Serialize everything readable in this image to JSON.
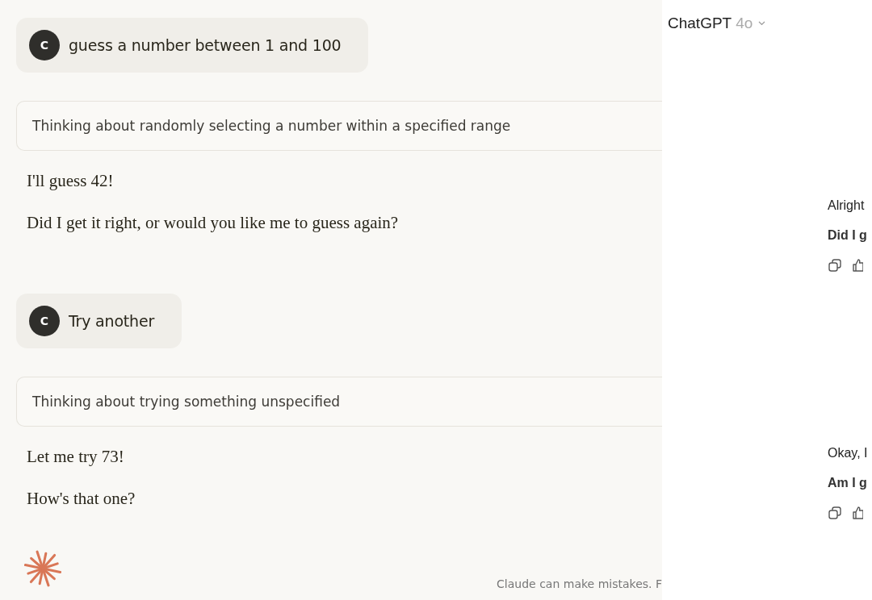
{
  "claude": {
    "turns": [
      {
        "kind": "user",
        "avatar": "C",
        "text": "guess a number between 1 and 100"
      },
      {
        "kind": "thinking",
        "text": "Thinking about randomly selecting a number within a specified range"
      },
      {
        "kind": "reply",
        "paragraphs": [
          "I'll guess 42!",
          "Did I get it right, or would you like me to guess again?"
        ]
      },
      {
        "kind": "user",
        "avatar": "C",
        "text": "Try another"
      },
      {
        "kind": "thinking",
        "text": "Thinking about trying something unspecified"
      },
      {
        "kind": "reply",
        "paragraphs": [
          "Let me try 73!",
          "How's that one?"
        ]
      }
    ],
    "disclaimer": "Claude can make mistakes. F"
  },
  "chatgpt": {
    "model_name": "ChatGPT",
    "model_version": "4o",
    "messages": [
      {
        "lines": [
          "Alright",
          "Did I g"
        ]
      },
      {
        "lines": [
          "Okay, I",
          "Am I g"
        ]
      }
    ]
  }
}
